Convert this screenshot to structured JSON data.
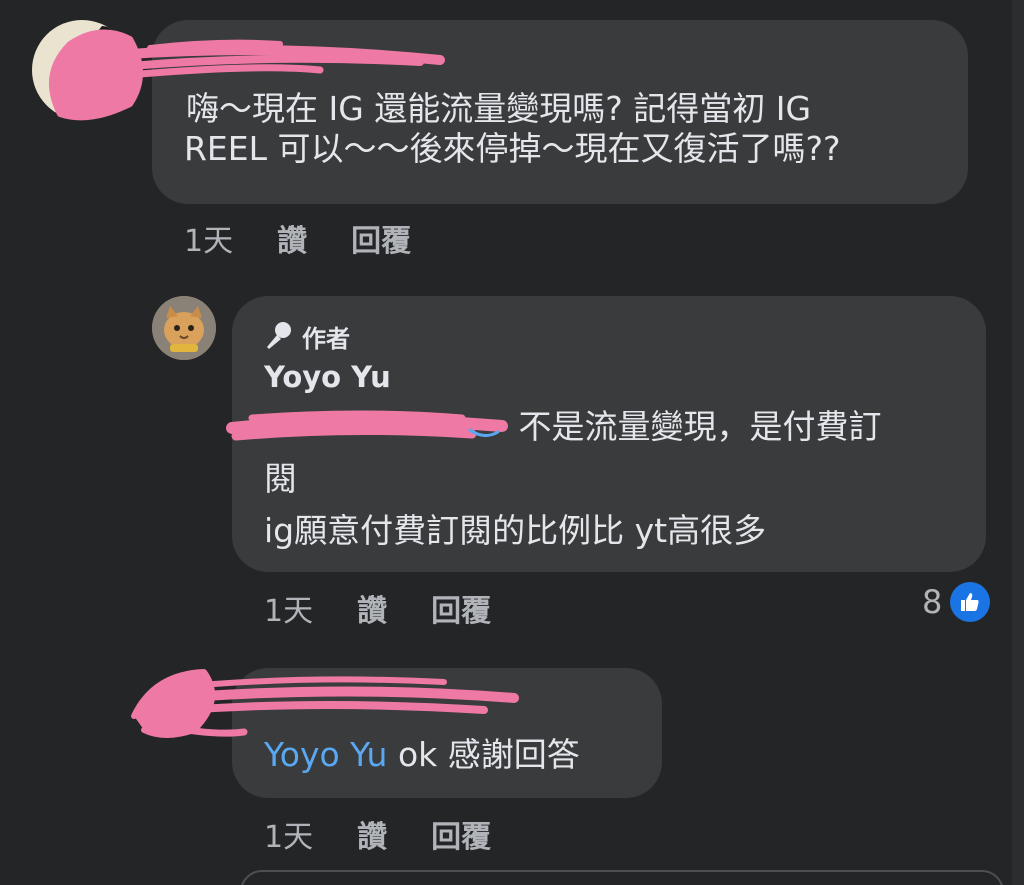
{
  "comments": [
    {
      "text_line1": "嗨～現在 IG 還能流量變現嗎? 記得當初 IG",
      "text_line2": "REEL 可以～～後來停掉～現在又復活了嗎??",
      "time": "1天",
      "like_label": "讚",
      "reply_label": "回覆"
    },
    {
      "badge": "作者",
      "author": "Yoyo Yu",
      "mention": "",
      "text_line1": " 不是流量變現，是付費訂",
      "text_line2": "閱",
      "text_line3": "ig願意付費訂閱的比例比 yt高很多",
      "time": "1天",
      "like_label": "讚",
      "reply_label": "回覆",
      "reaction_count": "8"
    },
    {
      "mention": "Yoyo Yu",
      "text": " ok 感謝回答",
      "time": "1天",
      "like_label": "讚",
      "reply_label": "回覆"
    }
  ],
  "icons": {
    "author_badge": "microphone-icon",
    "reaction": "thumbs-up-icon"
  },
  "colors": {
    "background": "#242526",
    "bubble": "#3a3b3c",
    "text": "#e4e6eb",
    "meta": "#b0b3b8",
    "mention": "#5aa7f2",
    "like_blue": "#1b74e4",
    "redaction_pink": "#ee79a5"
  }
}
